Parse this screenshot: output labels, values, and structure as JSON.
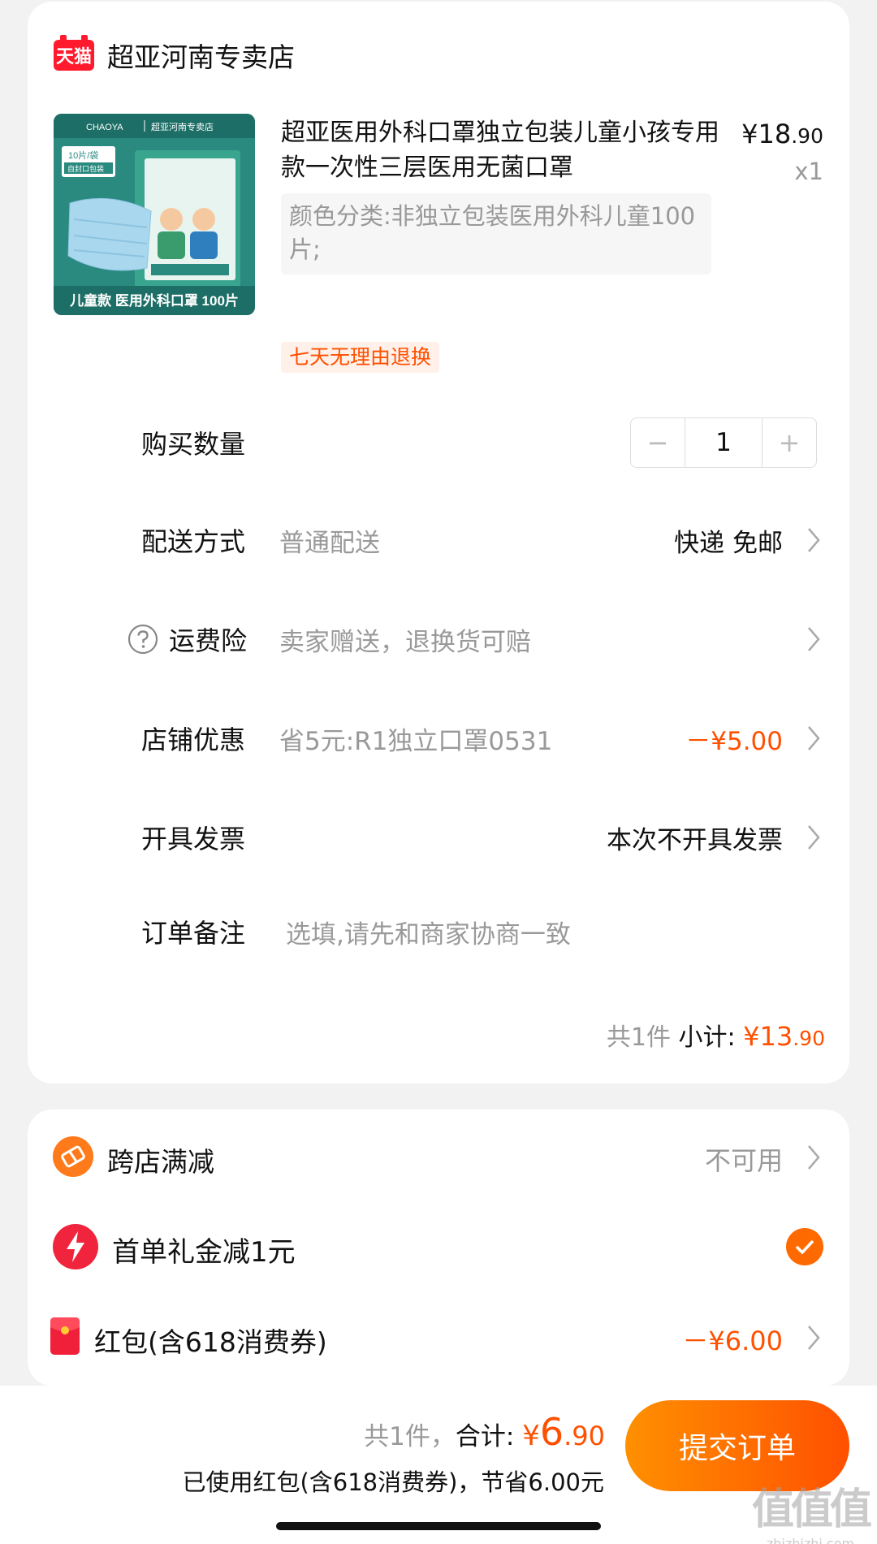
{
  "store": {
    "logo_text": "天猫",
    "name": "超亚河南专卖店"
  },
  "product": {
    "image": {
      "brand": "CHAOYA",
      "store": "超亚河南专卖店",
      "pack": "10片/袋",
      "pack_sub": "自封口包装",
      "banner": "儿童款 医用外科口罩 100片"
    },
    "title": "超亚医用外科口罩独立包装儿童小孩专用款一次性三层医用无菌口罩",
    "price_int": "¥18",
    "price_dec": ".90",
    "qty": "x1",
    "sku": "颜色分类:非独立包装医用外科儿童100片;",
    "return_tag": "七天无理由退换"
  },
  "rows": {
    "quantity": {
      "label": "购买数量",
      "value": "1",
      "minus": "−",
      "plus": "+"
    },
    "delivery": {
      "label": "配送方式",
      "value": "普通配送",
      "right": "快递 免邮"
    },
    "insurance": {
      "label": "运费险",
      "value": "卖家赠送，退换货可赔"
    },
    "discount": {
      "label": "店铺优惠",
      "value": "省5元:R1独立口罩0531",
      "right": "－¥5.00"
    },
    "invoice": {
      "label": "开具发票",
      "right": "本次不开具发票"
    },
    "note": {
      "label": "订单备注",
      "placeholder": "选填,请先和商家协商一致"
    }
  },
  "subtotal": {
    "count": "共1件",
    "label": "小计:",
    "price_int": "¥13",
    "price_dec": ".90"
  },
  "promos": {
    "cross_store": {
      "label": "跨店满减",
      "right": "不可用"
    },
    "first_order": {
      "label": "首单礼金减1元"
    },
    "red_packet": {
      "label": "红包(含618消费券)",
      "right": "－¥6.00"
    }
  },
  "footer": {
    "count": "共1件，",
    "total_label": "合计:",
    "yen": "¥",
    "total_int": "6",
    "total_dec": ".90",
    "saved": "已使用红包(含618消费券)，节省6.00元",
    "submit": "提交订单",
    "watermark_main": "值值值",
    "watermark_sub": "zhizhizhi.com"
  },
  "colors": {
    "accent": "#ff5000",
    "tmall_red": "#ff1a2e",
    "background": "#f2f2f2"
  }
}
